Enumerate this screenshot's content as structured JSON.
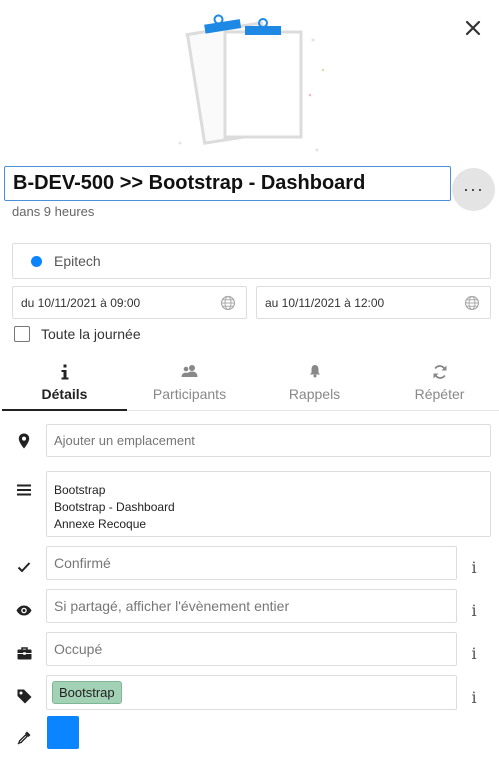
{
  "header": {
    "title": "B-DEV-500 >> Bootstrap - Dashboard",
    "relative_time": "dans 9 heures",
    "more_label": "···"
  },
  "calendar": {
    "name": "Epitech",
    "color": "#0a84ff"
  },
  "dates": {
    "start": "du 10/11/2021 à 09:00",
    "end": "au 10/11/2021 à 12:00"
  },
  "all_day": {
    "label": "Toute la journée",
    "checked": false
  },
  "tabs": [
    {
      "label": "Détails",
      "icon": "info-icon",
      "active": true
    },
    {
      "label": "Participants",
      "icon": "people-icon",
      "active": false
    },
    {
      "label": "Rappels",
      "icon": "bell-icon",
      "active": false
    },
    {
      "label": "Répéter",
      "icon": "repeat-icon",
      "active": false
    }
  ],
  "details": {
    "location_placeholder": "Ajouter un emplacement",
    "description_lines": [
      "Bootstrap",
      "Bootstrap - Dashboard",
      "Annexe Recoque"
    ],
    "status": "Confirmé",
    "access": "Si partagé, afficher l'évènement entier",
    "availability": "Occupé",
    "tags": [
      "Bootstrap"
    ],
    "info_label": "i",
    "event_color": "#0a84ff"
  }
}
